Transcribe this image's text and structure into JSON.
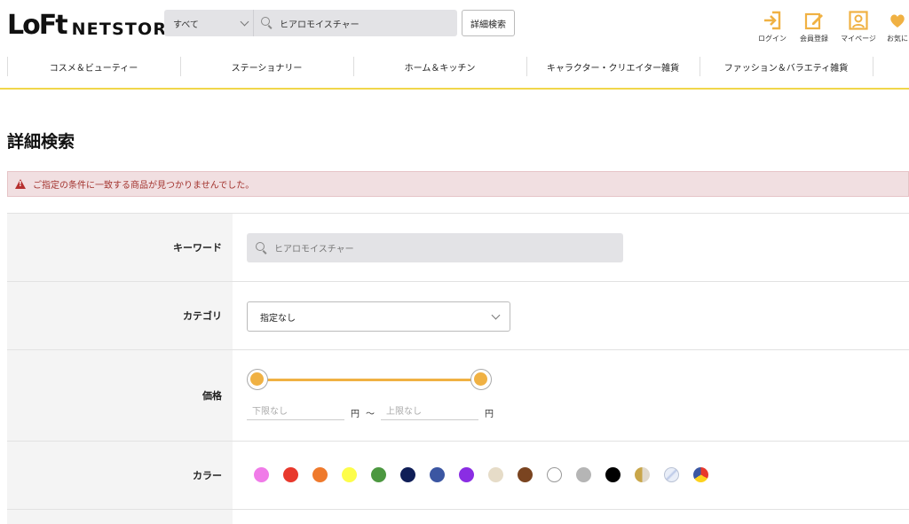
{
  "header": {
    "logo_main": "LoFt",
    "logo_sub": "NETSTORE",
    "search_scope": "すべて",
    "search_value": "ヒアロモイスチャー",
    "advanced_button": "詳細検索",
    "icons": [
      {
        "name": "login-icon",
        "label": "ログイン"
      },
      {
        "name": "register-icon",
        "label": "会員登録"
      },
      {
        "name": "mypage-icon",
        "label": "マイページ"
      },
      {
        "name": "favorite-icon",
        "label": "お気に"
      }
    ]
  },
  "nav": {
    "items": [
      "コスメ＆ビューティー",
      "ステーショナリー",
      "ホーム＆キッチン",
      "キャラクター・クリエイター雑貨",
      "ファッション＆バラエティ雑貨"
    ]
  },
  "page_title": "詳細検索",
  "alert": "ご指定の条件に一致する商品が見つかりませんでした。",
  "form": {
    "keyword": {
      "label": "キーワード",
      "placeholder": "ヒアロモイスチャー"
    },
    "category": {
      "label": "カテゴリ",
      "selected": "指定なし"
    },
    "price": {
      "label": "価格",
      "min_placeholder": "下限なし",
      "max_placeholder": "上限なし",
      "unit": "円",
      "tilde": "〜"
    },
    "color": {
      "label": "カラー"
    }
  },
  "colors": {
    "accent": "#f0b143",
    "nav_line": "#f1d64a",
    "alert_bg": "#f1dfe1",
    "alert_text": "#a3342f",
    "swatches": [
      "#f07be8",
      "#e8382c",
      "#ef7a2c",
      "#fdfd4a",
      "#4c9840",
      "#0f1e57",
      "#3b56a2",
      "#8a2de3",
      "#e6dcc8",
      "#7a4420",
      "#ffffff",
      "#b5b5b5",
      "#000000",
      "gold-beige",
      "clear",
      "multi"
    ]
  }
}
